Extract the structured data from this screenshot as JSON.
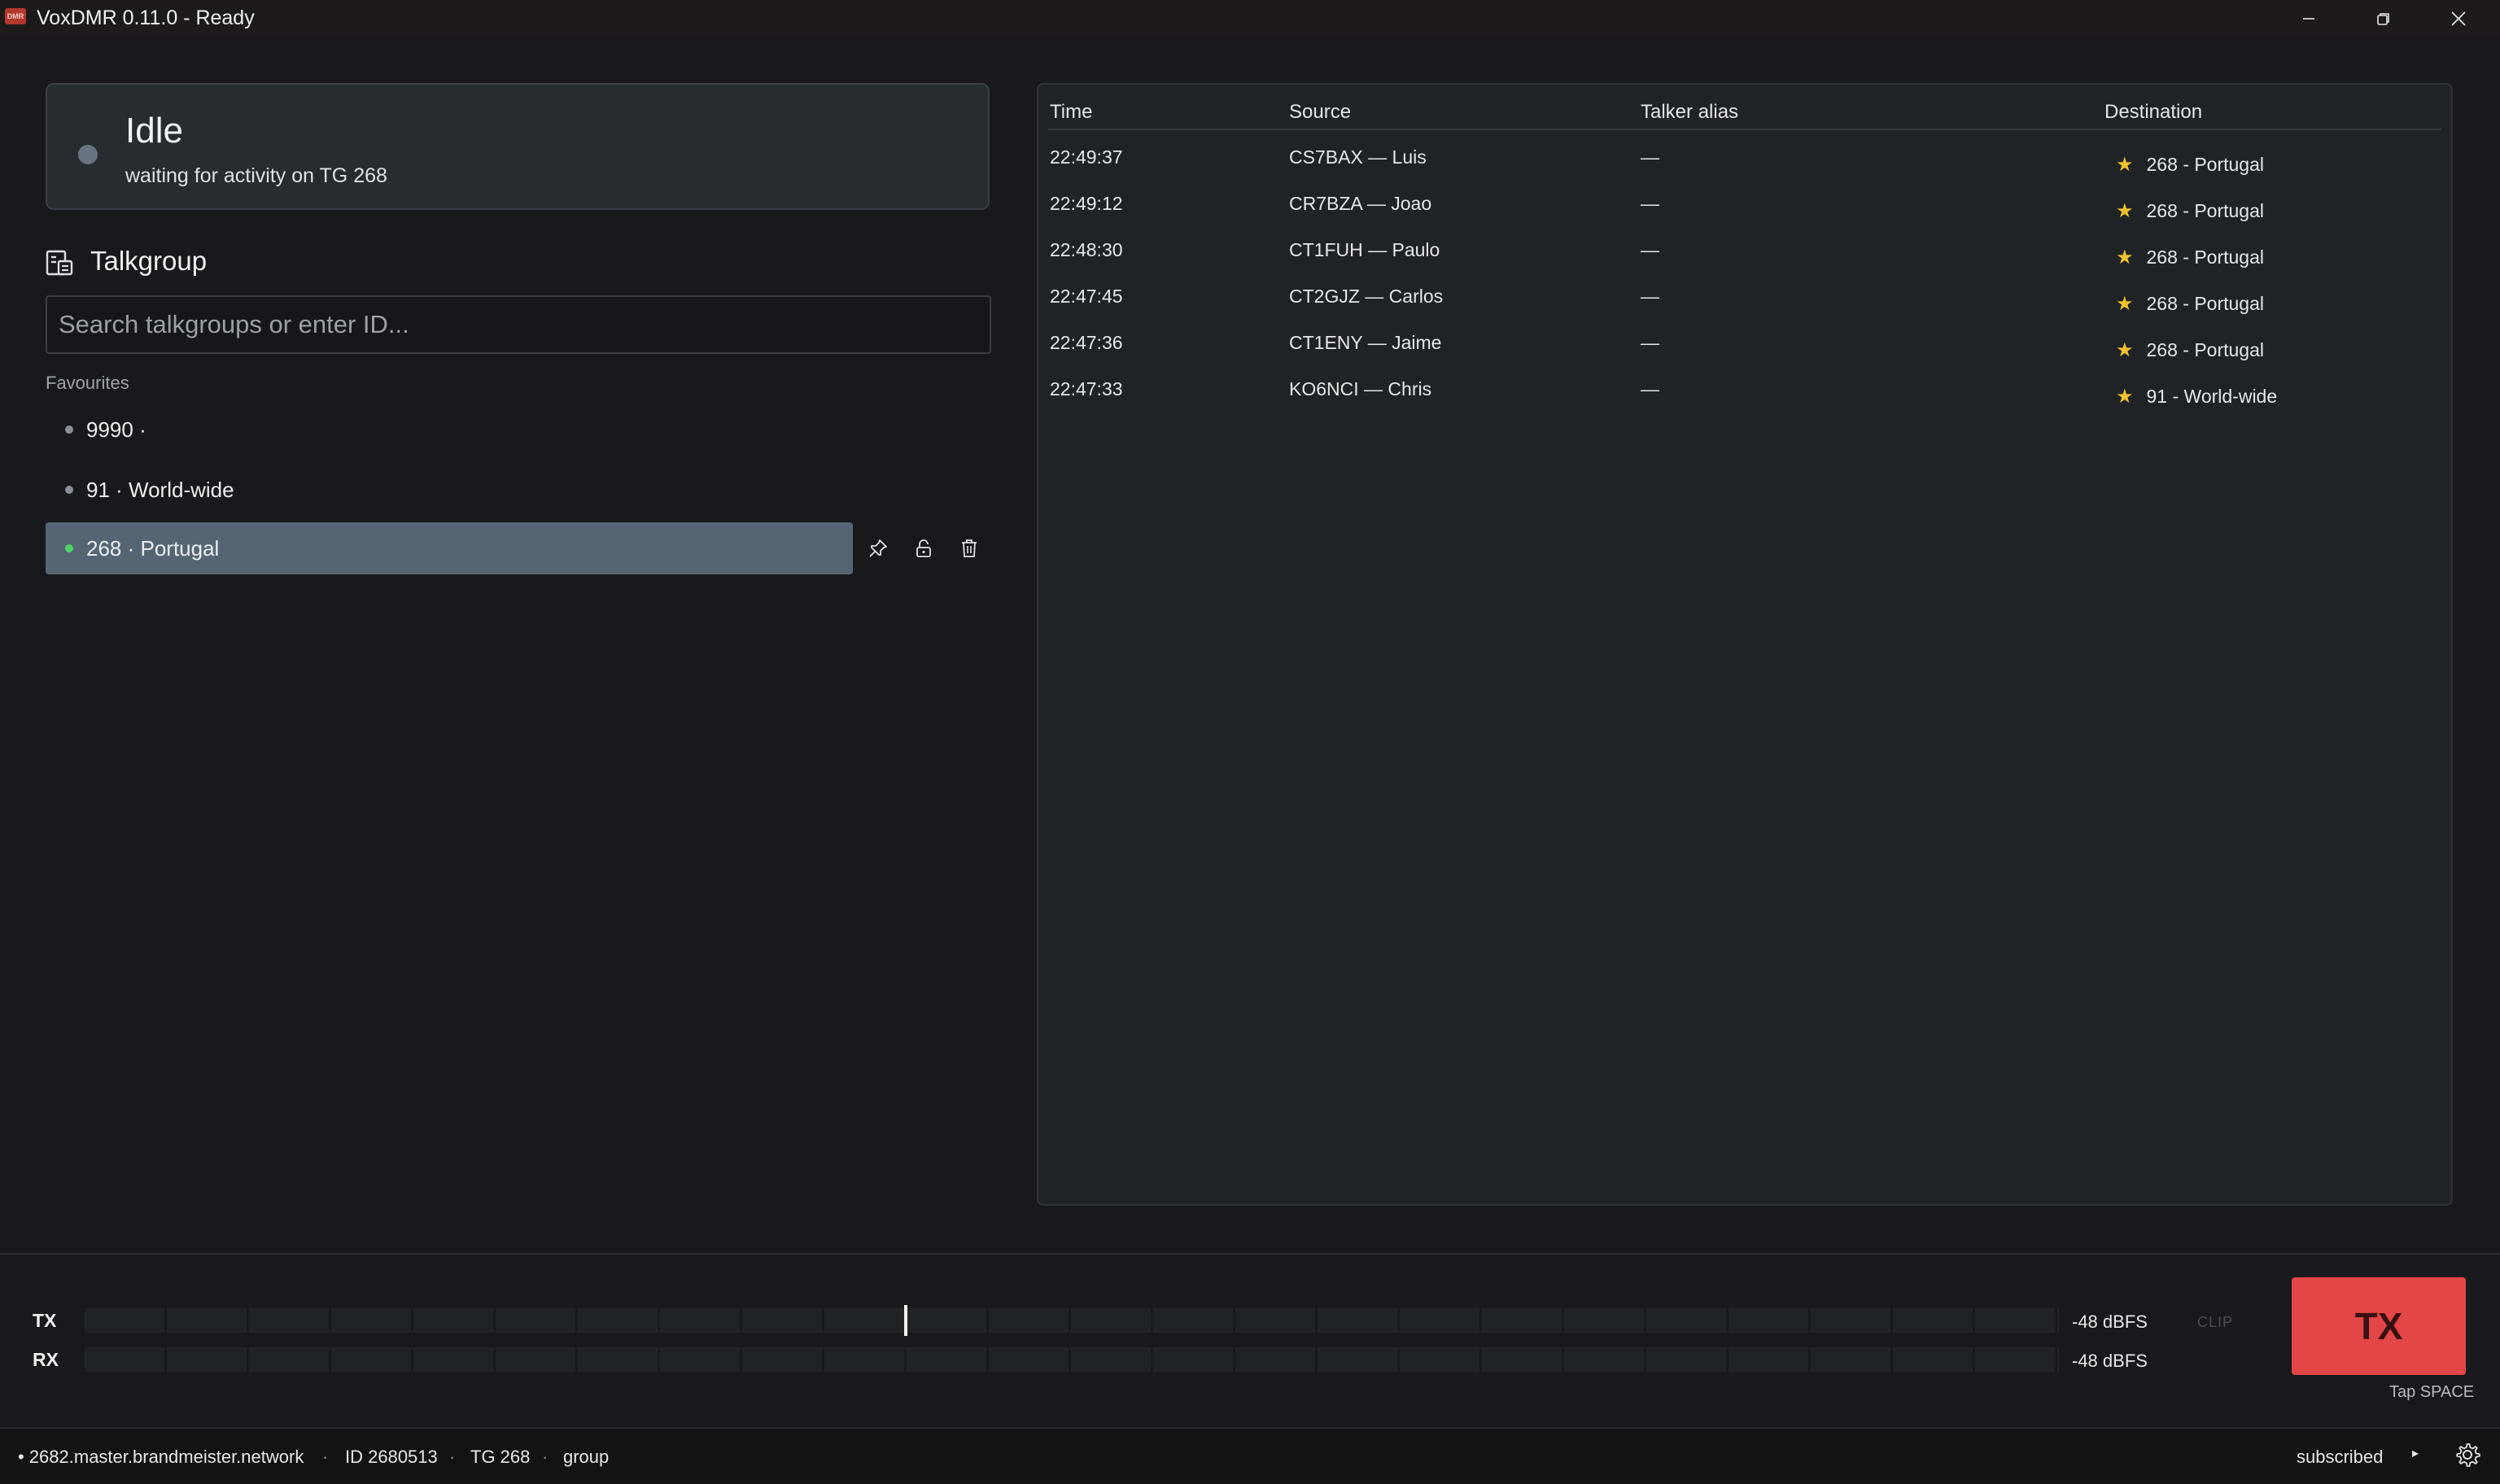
{
  "window": {
    "title": "VoxDMR 0.11.0 - Ready",
    "app_icon_text": "DMR",
    "buttons": [
      "minimize-icon",
      "restore-icon",
      "close-icon"
    ]
  },
  "status": {
    "title": "Idle",
    "subtitle": "waiting for activity on TG 268",
    "dot_color": "#6a7480"
  },
  "talkgroup": {
    "heading": "Talkgroup",
    "icon": "talkgroup-icon",
    "search_placeholder": "Search talkgroups or enter ID...",
    "favourites_label": "Favourites",
    "favourites": [
      {
        "label": "9990 ·",
        "selected": false
      },
      {
        "label": "91 · World-wide",
        "selected": false
      },
      {
        "label": "268 · Portugal",
        "selected": true
      }
    ],
    "actions": [
      "pin-icon",
      "lock-icon",
      "trash-icon"
    ],
    "selected_color": "#566573",
    "active_dot_color": "#4cd46a"
  },
  "activity": {
    "columns": {
      "time": "Time",
      "source": "Source",
      "alias": "Talker alias",
      "destination": "Destination"
    },
    "star_color": "#f2c12e",
    "rows": [
      {
        "time": "22:49:37",
        "source": "CS7BAX — Luis",
        "alias": "—",
        "star": "★",
        "destination": "268 - Portugal"
      },
      {
        "time": "22:49:12",
        "source": "CR7BZA — Joao",
        "alias": "—",
        "star": "★",
        "destination": "268 - Portugal"
      },
      {
        "time": "22:48:30",
        "source": "CT1FUH — Paulo",
        "alias": "—",
        "star": "★",
        "destination": "268 - Portugal"
      },
      {
        "time": "22:47:45",
        "source": "CT2GJZ — Carlos",
        "alias": "—",
        "star": "★",
        "destination": "268 - Portugal"
      },
      {
        "time": "22:47:36",
        "source": "CT1ENY — Jaime",
        "alias": "—",
        "star": "★",
        "destination": "268 - Portugal"
      },
      {
        "time": "22:47:33",
        "source": "KO6NCI — Chris",
        "alias": "—",
        "star": "★",
        "destination": "91 - World-wide"
      }
    ]
  },
  "meters": {
    "tx": {
      "label": "TX",
      "level_dbfs": "-48 dBFS",
      "fill_fraction": 0.0,
      "peak_fraction": 0.415
    },
    "rx": {
      "label": "RX",
      "level_dbfs": "-48 dBFS",
      "fill_fraction": 0.0
    },
    "clip_label": "CLIP"
  },
  "tx_button": {
    "label": "TX",
    "hint": "Tap SPACE",
    "color": "#e24646"
  },
  "footer": {
    "server": "• 2682.master.brandmeister.network",
    "separator": "·",
    "id": "ID 2680513",
    "tg": "TG 268",
    "mode": "group",
    "subscription": "subscribed",
    "play_icon": "▸",
    "settings_icon": "gear-icon"
  }
}
